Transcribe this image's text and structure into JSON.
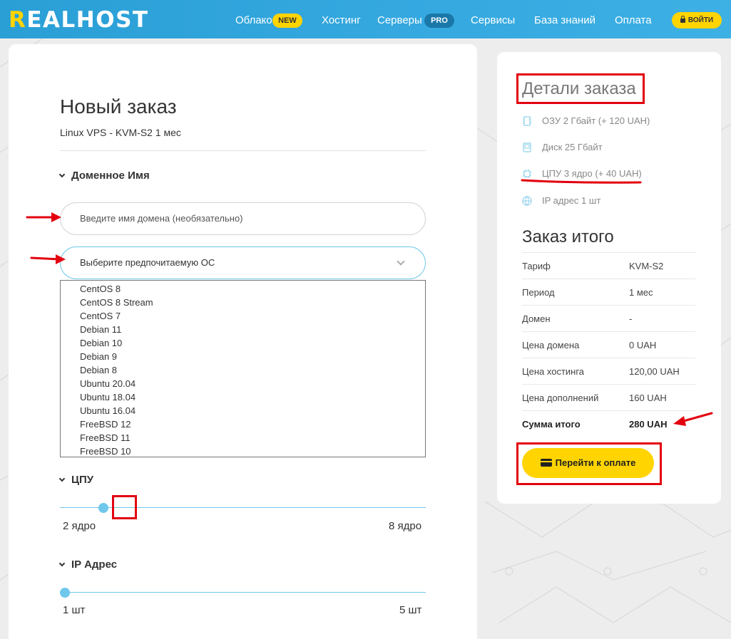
{
  "header": {
    "logo_prefix": "R",
    "logo_rest": "EALHOST",
    "nav": [
      {
        "label": "Облако",
        "badge": "NEW"
      },
      {
        "label": "Хостинг"
      },
      {
        "label": "Серверы",
        "badge": "PRO"
      },
      {
        "label": "Сервисы"
      },
      {
        "label": "База знаний"
      },
      {
        "label": "Оплата"
      }
    ],
    "login_label": "ВОЙТИ"
  },
  "order": {
    "title": "Новый заказ",
    "subtitle": "Linux VPS - KVM-S2 1 мес",
    "domain_section": "Доменное Имя",
    "domain_placeholder": "Введите имя домена (необязательно)",
    "os_select_label": "Выберите предпочитаемую ОС",
    "os_options": [
      "CentOS 8",
      "CentOS 8 Stream",
      "CentOS 7",
      "Debian 11",
      "Debian 10",
      "Debian 9",
      "Debian 8",
      "Ubuntu 20.04",
      "Ubuntu 18.04",
      "Ubuntu 16.04",
      "FreeBSD 12",
      "FreeBSD 11",
      "FreeBSD 10"
    ],
    "cpu_section": "ЦПУ",
    "cpu_min": "2 ядро",
    "cpu_max": "8 ядро",
    "cpu_value": 3,
    "cpu_range": [
      2,
      8
    ],
    "ip_section": "IP Адрес",
    "ip_min": "1 шт",
    "ip_max": "5 шт",
    "ip_value": 1,
    "ip_range": [
      1,
      5
    ]
  },
  "details": {
    "title": "Детали заказа",
    "features": [
      {
        "icon": "ram-icon",
        "text": "ОЗУ 2 Гбайт (+ 120 UAH)"
      },
      {
        "icon": "disk-icon",
        "text": "Диск 25 Гбайт"
      },
      {
        "icon": "cpu-icon",
        "text": "ЦПУ 3 ядро (+ 40 UAH)"
      },
      {
        "icon": "globe-icon",
        "text": "IP адрес 1 шт"
      }
    ],
    "total_title": "Заказ итого",
    "rows": [
      {
        "k": "Тариф",
        "v": "KVM-S2"
      },
      {
        "k": "Период",
        "v": "1 мес"
      },
      {
        "k": "Домен",
        "v": "-"
      },
      {
        "k": "Цена домена",
        "v": "0 UAH"
      },
      {
        "k": "Цена хостинга",
        "v": "120,00 UAH"
      },
      {
        "k": "Цена дополнений",
        "v": "160 UAH"
      },
      {
        "k": "Сумма итого",
        "v": "280 UAH"
      }
    ],
    "pay_label": "Перейти к оплате"
  },
  "colors": {
    "accent": "#2a9fd6",
    "yellow": "#ffd400",
    "annotation": "#e3000f",
    "slider": "#6fc8ec"
  }
}
